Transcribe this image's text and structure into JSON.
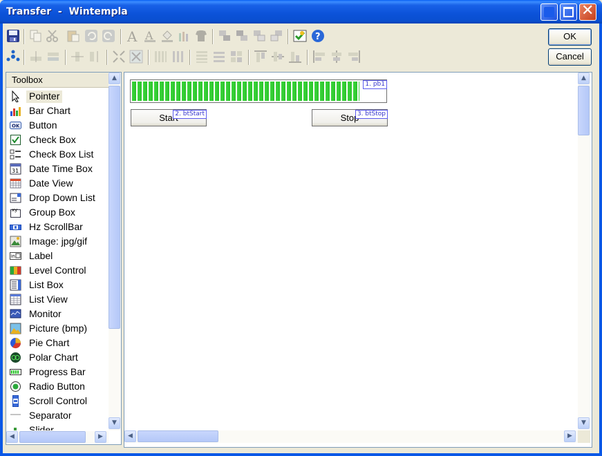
{
  "window": {
    "title": "Transfer  -  Wintempla"
  },
  "dialog": {
    "ok_label": "OK",
    "cancel_label": "Cancel"
  },
  "toolbox": {
    "header": "Toolbox",
    "items": [
      {
        "label": "Pointer",
        "icon": "pointer-icon"
      },
      {
        "label": "Bar Chart",
        "icon": "bar-chart-icon"
      },
      {
        "label": "Button",
        "icon": "button-icon"
      },
      {
        "label": "Check Box",
        "icon": "check-box-icon"
      },
      {
        "label": "Check Box List",
        "icon": "check-box-list-icon"
      },
      {
        "label": "Date Time Box",
        "icon": "date-time-box-icon"
      },
      {
        "label": "Date View",
        "icon": "date-view-icon"
      },
      {
        "label": "Drop Down List",
        "icon": "drop-down-list-icon"
      },
      {
        "label": "Group Box",
        "icon": "group-box-icon"
      },
      {
        "label": "Hz ScrollBar",
        "icon": "hz-scrollbar-icon"
      },
      {
        "label": "Image: jpg/gif",
        "icon": "image-icon"
      },
      {
        "label": "Label",
        "icon": "label-icon"
      },
      {
        "label": "Level Control",
        "icon": "level-control-icon"
      },
      {
        "label": "List Box",
        "icon": "list-box-icon"
      },
      {
        "label": "List View",
        "icon": "list-view-icon"
      },
      {
        "label": "Monitor",
        "icon": "monitor-icon"
      },
      {
        "label": "Picture (bmp)",
        "icon": "picture-icon"
      },
      {
        "label": "Pie Chart",
        "icon": "pie-chart-icon"
      },
      {
        "label": "Polar Chart",
        "icon": "polar-chart-icon"
      },
      {
        "label": "Progress Bar",
        "icon": "progress-bar-icon"
      },
      {
        "label": "Radio Button",
        "icon": "radio-button-icon"
      },
      {
        "label": "Scroll Control",
        "icon": "scroll-control-icon"
      },
      {
        "label": "Separator",
        "icon": "separator-icon"
      },
      {
        "label": "Slider",
        "icon": "slider-icon"
      }
    ],
    "selected": "Pointer",
    "group_box_icon_text": "xy",
    "button_icon_text": "OK",
    "date_icon_text": "31",
    "label_icon_text": "in"
  },
  "designer": {
    "progress_bar": {
      "tag": "1. pb1",
      "progress_percent": 90
    },
    "start_button": {
      "label": "Start",
      "tag": "2. btStart"
    },
    "stop_button": {
      "label": "Stop",
      "tag": "3. btStop"
    }
  },
  "colors": {
    "title_bar": "#0a58e6",
    "progress_fill": "#2cc42c",
    "tag_border": "#5a5aef"
  }
}
